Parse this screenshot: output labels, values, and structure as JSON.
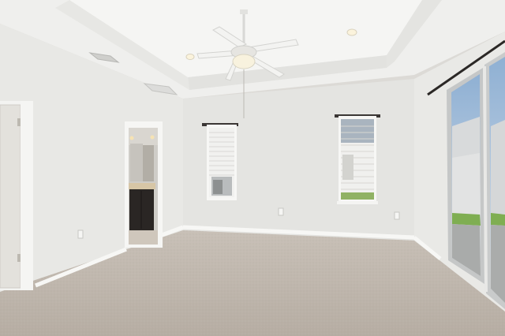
{
  "scene": {
    "description_label": "",
    "colors": {
      "ceiling": "#eeeeec",
      "ceiling_tray": "#f4f4f2",
      "wall_left": "#e9e9e6",
      "wall_back": "#e5e5e2",
      "wall_right": "#e8e8e5",
      "carpet": "#bdb4ab",
      "trim": "#f7f7f5",
      "door": "#e6e4df",
      "cabinet": "#2a2624",
      "sky": "#9fbad6",
      "grass": "#7fae52",
      "blind": "#f2f2f0"
    },
    "icons": [
      "ceiling-fan-icon",
      "recessed-light-icon",
      "air-vent-icon",
      "outlet-icon"
    ]
  }
}
